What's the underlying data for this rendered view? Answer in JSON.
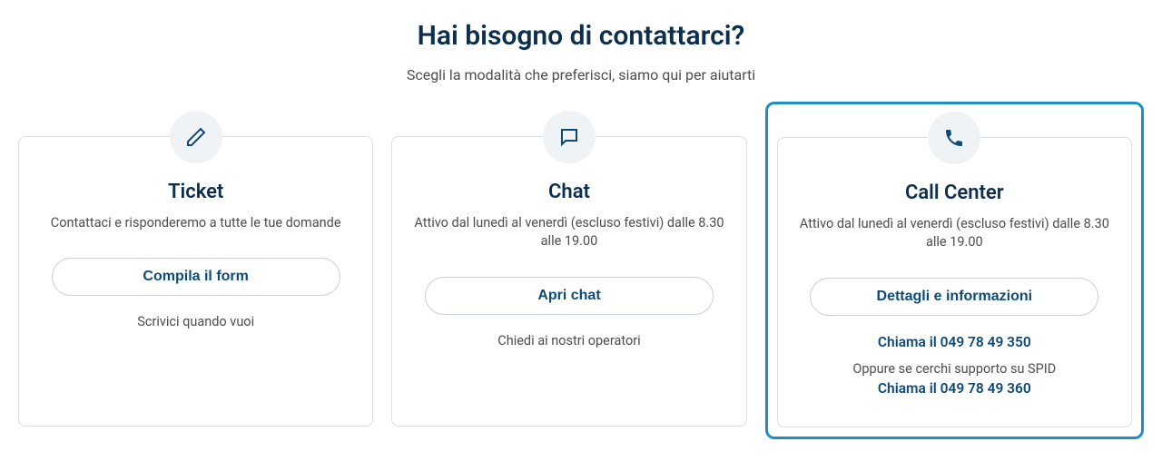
{
  "header": {
    "title": "Hai bisogno di contattarci?",
    "subtitle": "Scegli la modalità che preferisci, siamo qui per aiutarti"
  },
  "cards": {
    "ticket": {
      "title": "Ticket",
      "desc": "Contattaci e risponderemo a tutte le tue domande",
      "button": "Compila il form",
      "note": "Scrivici quando vuoi"
    },
    "chat": {
      "title": "Chat",
      "desc": "Attivo dal lunedì al venerdì (escluso festivi) dalle 8.30 alle 19.00",
      "button": "Apri chat",
      "note": "Chiedi ai nostri operatori"
    },
    "callcenter": {
      "title": "Call Center",
      "desc": "Attivo dal lunedì al venerdì (escluso festivi) dalle 8.30 alle 19.00",
      "button": "Dettagli e informazioni",
      "phone1": "Chiama il 049 78 49 350",
      "spid_note": "Oppure se cerchi supporto su SPID",
      "phone2": "Chiama il 049 78 49 360"
    }
  }
}
